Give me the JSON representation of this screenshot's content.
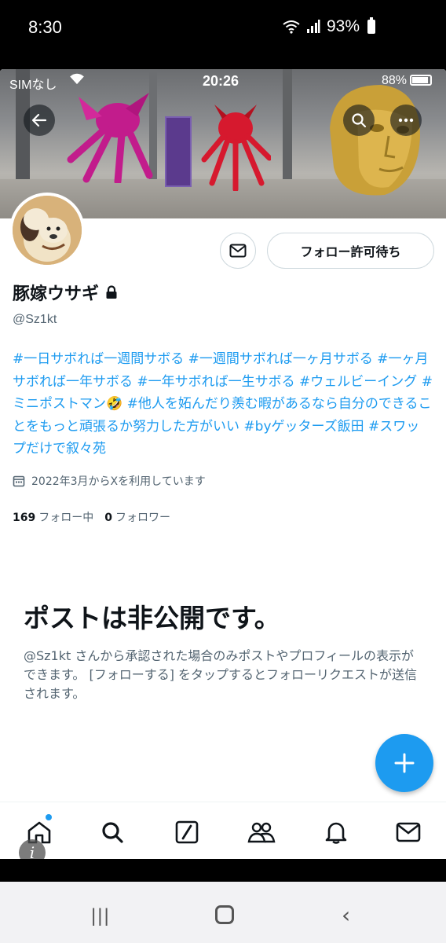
{
  "outer_status": {
    "time": "8:30",
    "battery": "93%"
  },
  "inner_status": {
    "carrier": "SIMなし",
    "time": "20:26",
    "battery": "88%"
  },
  "profile": {
    "display_name": "豚嫁ウサギ",
    "handle": "@Sz1kt",
    "bio": "#一日サボれば一週間サボる #一週間サボれば一ヶ月サボる #一ヶ月サボれば一年サボる #一年サボれば一生サボる #ウェルビーイング #ミニポストマン🤣 #他人を妬んだり羨む暇があるなら自分のできることをもっと頑張るか努力した方がいい #byゲッターズ飯田 #スワップだけで叙々苑",
    "joined": "2022年3月からXを利用しています",
    "following_count": "169",
    "following_label": "フォロー中",
    "followers_count": "0",
    "followers_label": "フォロワー"
  },
  "actions": {
    "follow_pending_label": "フォロー許可待ち"
  },
  "private_notice": {
    "title": "ポストは非公開です。",
    "description": "@Sz1kt さんから承認された場合のみポストやプロフィールの表示ができます。 [フォローする] をタップするとフォローリクエストが送信されます。"
  },
  "icons": {
    "back": "back-arrow-icon",
    "search": "search-icon",
    "more": "more-icon",
    "message": "mail-icon",
    "lock": "lock-icon",
    "calendar": "calendar-icon",
    "compose": "plus-icon",
    "home": "home-icon",
    "explore": "search-icon",
    "grok": "slash-box-icon",
    "communities": "people-icon",
    "notifications": "bell-icon",
    "messages": "mail-icon"
  },
  "colors": {
    "accent": "#1d9bf0",
    "text": "#0f1419",
    "secondary": "#536471"
  }
}
